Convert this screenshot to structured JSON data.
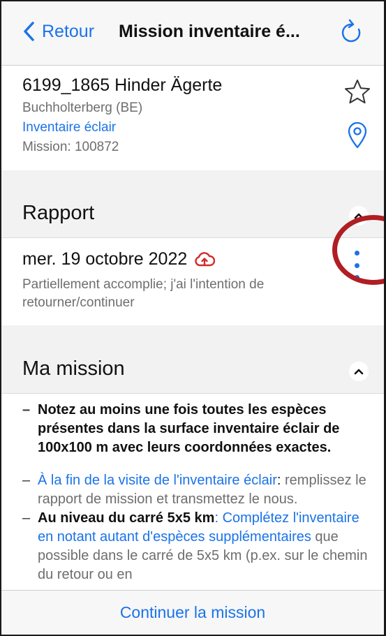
{
  "navbar": {
    "back_label": "Retour",
    "title": "Mission inventaire é..."
  },
  "site": {
    "name": "6199_1865 Hinder Ägerte",
    "commune": "Buchholterberg (BE)",
    "type": "Inventaire éclair",
    "mission": "Mission: 100872"
  },
  "report_section": {
    "title": "Rapport",
    "entry": {
      "date": "mer. 19 octobre 2022",
      "status": "Partiellement accomplie; j'ai l'intention de retourner/continuer"
    }
  },
  "mission_section": {
    "title": "Ma mission",
    "items": [
      {
        "text": "Notez au moins une fois toutes les espèces présentes dans la surface inventaire éclair de 100x100 m avec leurs coordonnées exactes."
      },
      {
        "link": "À la fin de la visite de l'inventaire éclair",
        "sep": ":",
        "rest": " remplissez le rapport de mission et transmettez le nous."
      },
      {
        "bold": "Au niveau du carré 5x5 km",
        "sep": ":",
        "link": " Complétez l'inventaire en notant autant d'espèces supplémentaires",
        "rest": " que possible dans le carré de 5x5 km (p.ex. sur le chemin du retour ou en"
      }
    ]
  },
  "footer": {
    "button_label": "Continuer la mission"
  },
  "colors": {
    "accent": "#1a73e8",
    "alert": "#d12b2b",
    "highlight_ring": "#b01e23"
  }
}
